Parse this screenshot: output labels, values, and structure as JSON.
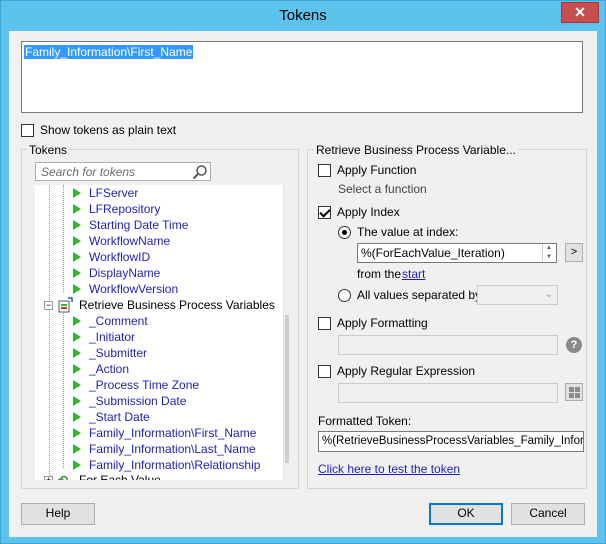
{
  "window": {
    "title": "Tokens",
    "close_glyph": "✕"
  },
  "token_editor": {
    "value": "Family_Information\\First_Name"
  },
  "show_plain_text": {
    "label": "Show tokens as plain text",
    "checked": false
  },
  "tokens_panel": {
    "group_label": "Tokens",
    "search_placeholder": "Search for tokens",
    "items": [
      {
        "label": "LFServer"
      },
      {
        "label": "LFRepository"
      },
      {
        "label": "Starting Date Time"
      },
      {
        "label": "WorkflowName"
      },
      {
        "label": "WorkflowID"
      },
      {
        "label": "DisplayName"
      },
      {
        "label": "WorkflowVersion"
      },
      {
        "label": "Retrieve Business Process Variables"
      },
      {
        "label": "_Comment"
      },
      {
        "label": "_Initiator"
      },
      {
        "label": "_Submitter"
      },
      {
        "label": "_Action"
      },
      {
        "label": "_Process Time Zone"
      },
      {
        "label": "_Submission Date"
      },
      {
        "label": "_Start Date"
      },
      {
        "label": "Family_Information\\First_Name"
      },
      {
        "label": "Family_Information\\Last_Name"
      },
      {
        "label": "Family_Information\\Relationship"
      },
      {
        "label": "For Each Value"
      }
    ]
  },
  "options_panel": {
    "group_label": "Retrieve Business Process Variable...",
    "apply_function": {
      "label": "Apply Function",
      "checked": false,
      "hint": "Select a function"
    },
    "apply_index": {
      "label": "Apply Index",
      "checked": true,
      "value_at_index_label": "The value at index:",
      "index_value": "%(ForEachValue_Iteration)",
      "from_the_label": "from the",
      "from_the_link": "start",
      "all_values_label": "All values separated by:",
      "browse_button": ">"
    },
    "apply_formatting": {
      "label": "Apply Formatting",
      "checked": false
    },
    "apply_regex": {
      "label": "Apply Regular Expression",
      "checked": false
    },
    "formatted_token_label": "Formatted Token:",
    "formatted_token_value": "%(RetrieveBusinessProcessVariables_Family_Informatio",
    "test_link": "Click here to test the token"
  },
  "buttons": {
    "help": "Help",
    "ok": "OK",
    "cancel": "Cancel"
  }
}
